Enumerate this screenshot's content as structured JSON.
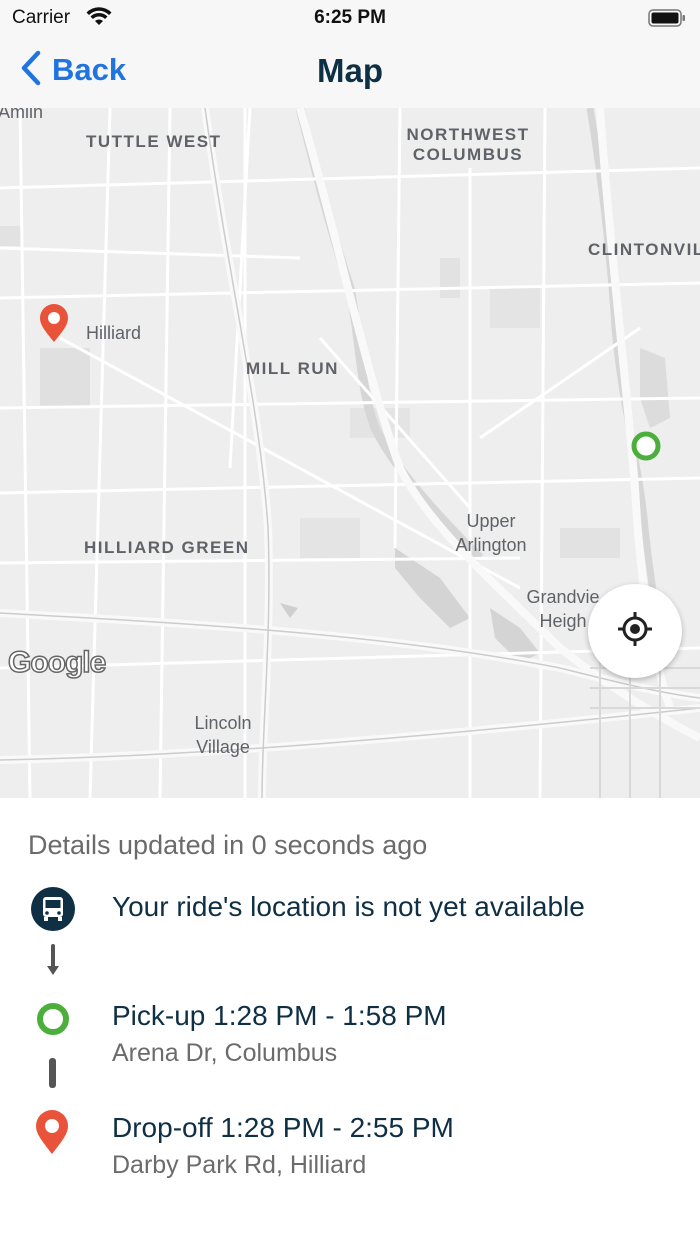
{
  "status_bar": {
    "carrier": "Carrier",
    "time": "6:25 PM"
  },
  "nav": {
    "back_label": "Back",
    "title": "Map"
  },
  "map": {
    "labels": {
      "amlin": "Amlin",
      "tuttle_west": "TUTTLE WEST",
      "northwest_columbus": "NORTHWEST COLUMBUS",
      "clintonville": "CLINTONVIL",
      "hilliard": "Hilliard",
      "mill_run": "MILL RUN",
      "hilliard_green": "HILLIARD GREEN",
      "upper_arlington": "Upper Arlington",
      "grandview_heights": "Grandvie Heigh",
      "lincoln_village": "Lincoln Village"
    },
    "attribution": "Google",
    "colors": {
      "pickup": "#4caf3c",
      "dropoff": "#e8533a",
      "background": "#eeeeee",
      "roads": "#ffffff"
    }
  },
  "details": {
    "updated_text": "Details updated in 0 seconds ago",
    "ride_status": "Your ride's location is not yet available",
    "pickup": {
      "title": "Pick-up 1:28 PM - 1:58 PM",
      "address": "Arena Dr, Columbus"
    },
    "dropoff": {
      "title": "Drop-off 1:28 PM - 2:55 PM",
      "address": "Darby Park Rd, Hilliard"
    }
  }
}
